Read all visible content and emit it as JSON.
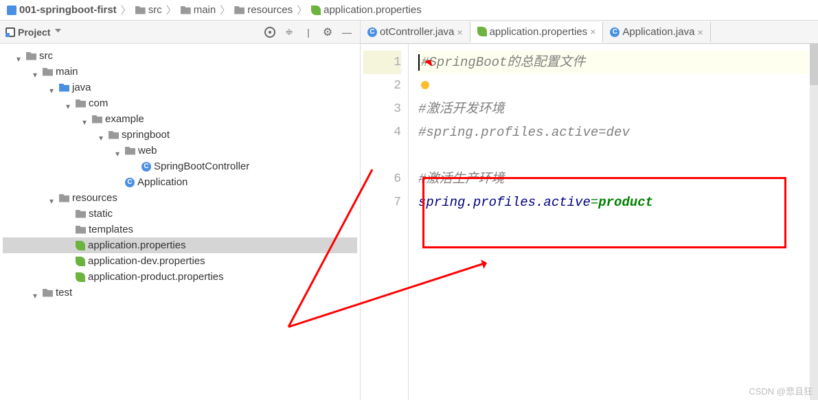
{
  "breadcrumb": [
    {
      "icon": "module",
      "label": "001-springboot-first"
    },
    {
      "icon": "folder",
      "label": "src"
    },
    {
      "icon": "folder",
      "label": "main"
    },
    {
      "icon": "folder-res",
      "label": "resources"
    },
    {
      "icon": "leaf",
      "label": "application.properties"
    }
  ],
  "sidebar_title": "Project",
  "tree": {
    "nodes": [
      {
        "indent": "in1",
        "arrow": "down",
        "icon": "folder",
        "label": "src"
      },
      {
        "indent": "in2",
        "arrow": "down",
        "icon": "folder",
        "label": "main"
      },
      {
        "indent": "in3",
        "arrow": "down",
        "icon": "folder-blue",
        "label": "java"
      },
      {
        "indent": "in4",
        "arrow": "down",
        "icon": "folder",
        "label": "com"
      },
      {
        "indent": "in5",
        "arrow": "down",
        "icon": "folder",
        "label": "example"
      },
      {
        "indent": "in6",
        "arrow": "down",
        "icon": "folder",
        "label": "springboot"
      },
      {
        "indent": "in7",
        "arrow": "down",
        "icon": "folder",
        "label": "web"
      },
      {
        "indent": "in8",
        "arrow": "blank",
        "icon": "class-c",
        "label": "SpringBootController"
      },
      {
        "indent": "in7",
        "arrow": "blank",
        "icon": "class-c-run",
        "label": "Application"
      },
      {
        "indent": "in3",
        "arrow": "down",
        "icon": "folder-res",
        "label": "resources"
      },
      {
        "indent": "in4",
        "arrow": "blank",
        "icon": "folder",
        "label": "static"
      },
      {
        "indent": "in4",
        "arrow": "blank",
        "icon": "folder",
        "label": "templates"
      },
      {
        "indent": "in4",
        "arrow": "blank",
        "icon": "leaf",
        "label": "application.properties",
        "selected": true
      },
      {
        "indent": "in4",
        "arrow": "blank",
        "icon": "leaf",
        "label": "application-dev.properties"
      },
      {
        "indent": "in4",
        "arrow": "blank",
        "icon": "leaf",
        "label": "application-product.properties"
      },
      {
        "indent": "in2",
        "arrow": "down",
        "icon": "folder",
        "label": "test"
      }
    ]
  },
  "tabs": [
    {
      "icon": "class-c",
      "label": "otController.java",
      "active": false,
      "truncated": true
    },
    {
      "icon": "leaf",
      "label": "application.properties",
      "active": true
    },
    {
      "icon": "class-c-run",
      "label": "Application.java",
      "active": false
    }
  ],
  "code": {
    "lines": [
      {
        "num": "1",
        "hl": true,
        "content": [
          {
            "type": "comment",
            "text": "#SpringBoot的总配置文件"
          }
        ],
        "cursor": true
      },
      {
        "num": "2",
        "content": [
          {
            "type": "bulb"
          }
        ]
      },
      {
        "num": "3",
        "content": [
          {
            "type": "comment",
            "text": "#激活开发环境"
          }
        ]
      },
      {
        "num": "4",
        "content": [
          {
            "type": "comment",
            "text": "#spring.profiles.active=dev"
          }
        ]
      },
      {
        "num": "",
        "content": []
      },
      {
        "num": "6",
        "content": [
          {
            "type": "comment",
            "text": "#激活生产环境"
          }
        ]
      },
      {
        "num": "7",
        "content": [
          {
            "type": "key",
            "text": "spring.profiles.active"
          },
          {
            "type": "eq",
            "text": "="
          },
          {
            "type": "val",
            "text": "product"
          }
        ]
      }
    ]
  },
  "watermark": "CSDN @悲且狂"
}
